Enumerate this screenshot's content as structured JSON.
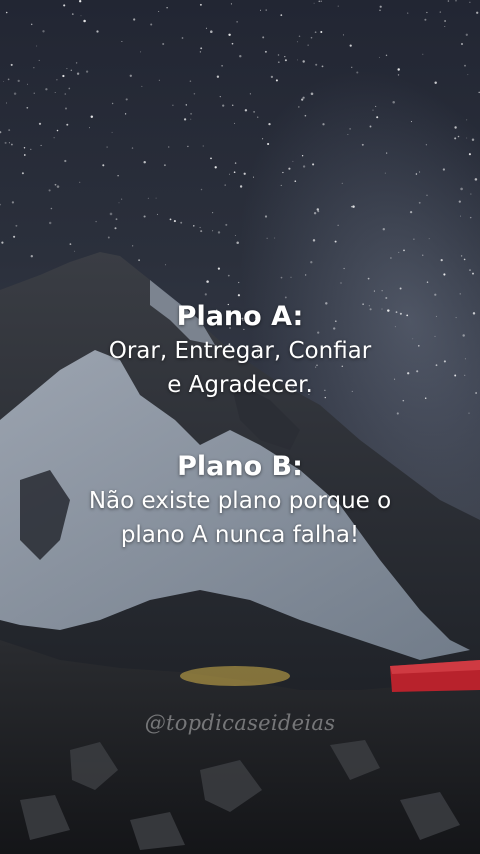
{
  "plan_a": {
    "heading": "Plano A:",
    "lines": [
      "Orar, Entregar, Confiar",
      "e Agradecer."
    ]
  },
  "plan_b": {
    "heading": "Plano B:",
    "lines": [
      "Não existe plano porque o",
      "plano A nunca falha!"
    ]
  },
  "watermark": "@topdicaseideias",
  "colors": {
    "text": "#ffffff",
    "tent": "#b8222c",
    "glow": "#d6b54a"
  }
}
